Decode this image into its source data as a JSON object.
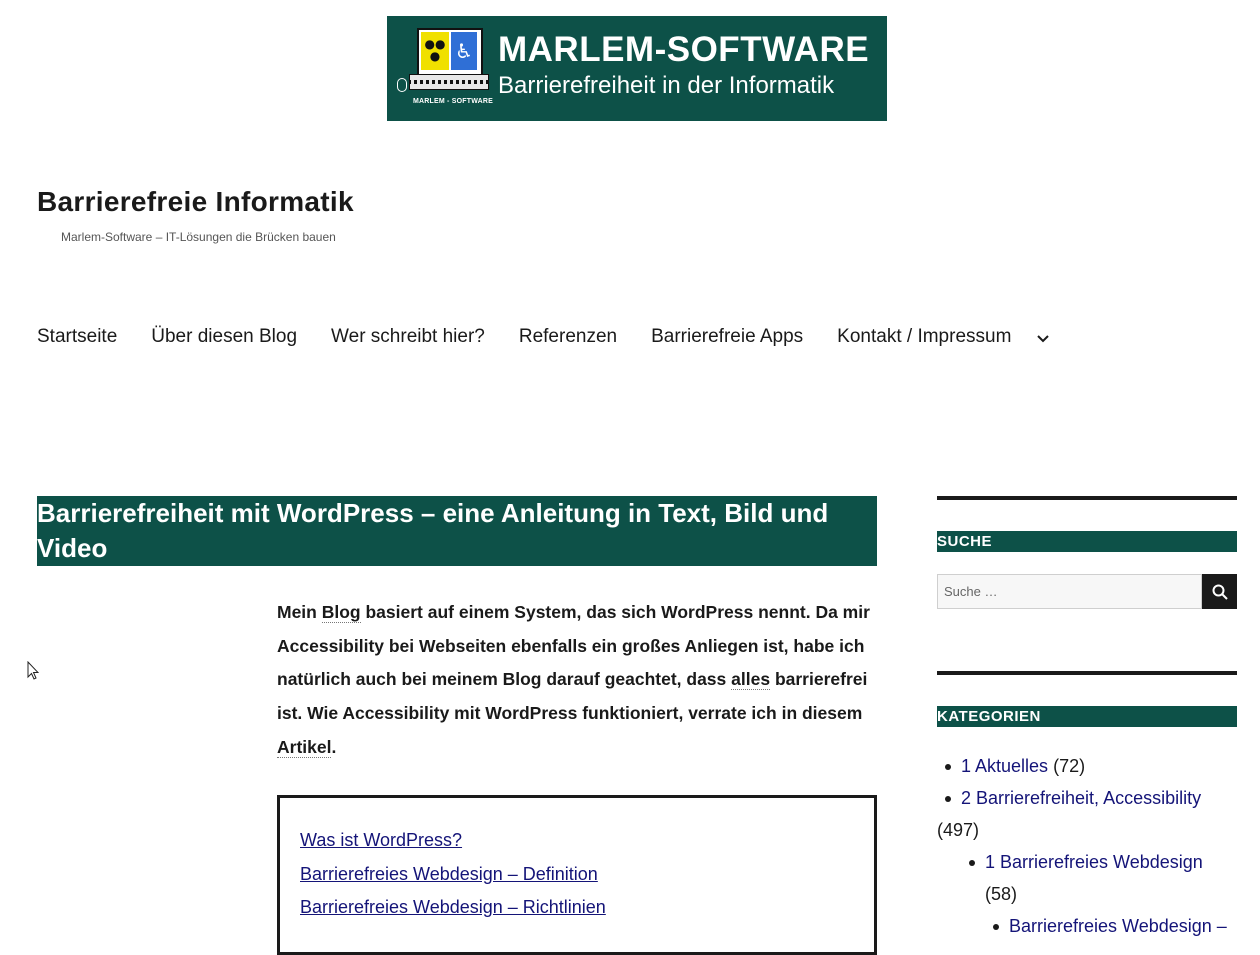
{
  "banner": {
    "brand": "MARLEM-SOFTWARE",
    "slogan": "Barrierefreiheit in der Informatik",
    "small_label": "MARLEM - SOFTWARE"
  },
  "site": {
    "title": "Barrierefreie Informatik",
    "tagline": "Marlem-Software – IT-Lösungen die Brücken bauen"
  },
  "nav": {
    "items": [
      "Startseite",
      "Über diesen Blog",
      "Wer schreibt hier?",
      "Referenzen",
      "Barrierefreie Apps",
      "Kontakt / Impressum"
    ],
    "more_icon": "chevron-down-icon"
  },
  "post": {
    "title": "Barrierefreiheit mit WordPress – eine Anleitung in Text, Bild und Video",
    "intro": {
      "p1": "Mein ",
      "abbr1": "Blog",
      "p2": " basiert auf einem System, das sich WordPress nennt. Da mir Accessibility bei Webseiten ebenfalls ein großes Anliegen ist, habe ich natürlich auch bei meinem Blog darauf geachtet, dass ",
      "abbr2": "alles",
      "p3": " barrierefrei ist. Wie Accessibility mit WordPress funktioniert, verrate ich in diesem ",
      "abbr3": "Artikel",
      "p4": "."
    },
    "toc": [
      "Was ist WordPress?",
      "Barrierefreies Webdesign – Definition",
      "Barrierefreies Webdesign – Richtlinien"
    ]
  },
  "sidebar": {
    "search": {
      "heading": "SUCHE",
      "placeholder": "Suche …",
      "button_icon": "search-icon"
    },
    "categories": {
      "heading": "KATEGORIEN",
      "items": [
        {
          "label": "1 Aktuelles",
          "count": "(72)",
          "level": 1
        },
        {
          "label": "2 Barrierefreiheit, Accessibility",
          "count": "(497)",
          "level": 1
        },
        {
          "label": "1 Barrierefreies Webdesign",
          "count": "(58)",
          "level": 2
        },
        {
          "label": "Barrierefreies Webdesign –",
          "count": "",
          "level": 3
        }
      ]
    }
  },
  "colors": {
    "accent": "#0d5148",
    "link": "#141478",
    "text": "#1a1a1a"
  }
}
